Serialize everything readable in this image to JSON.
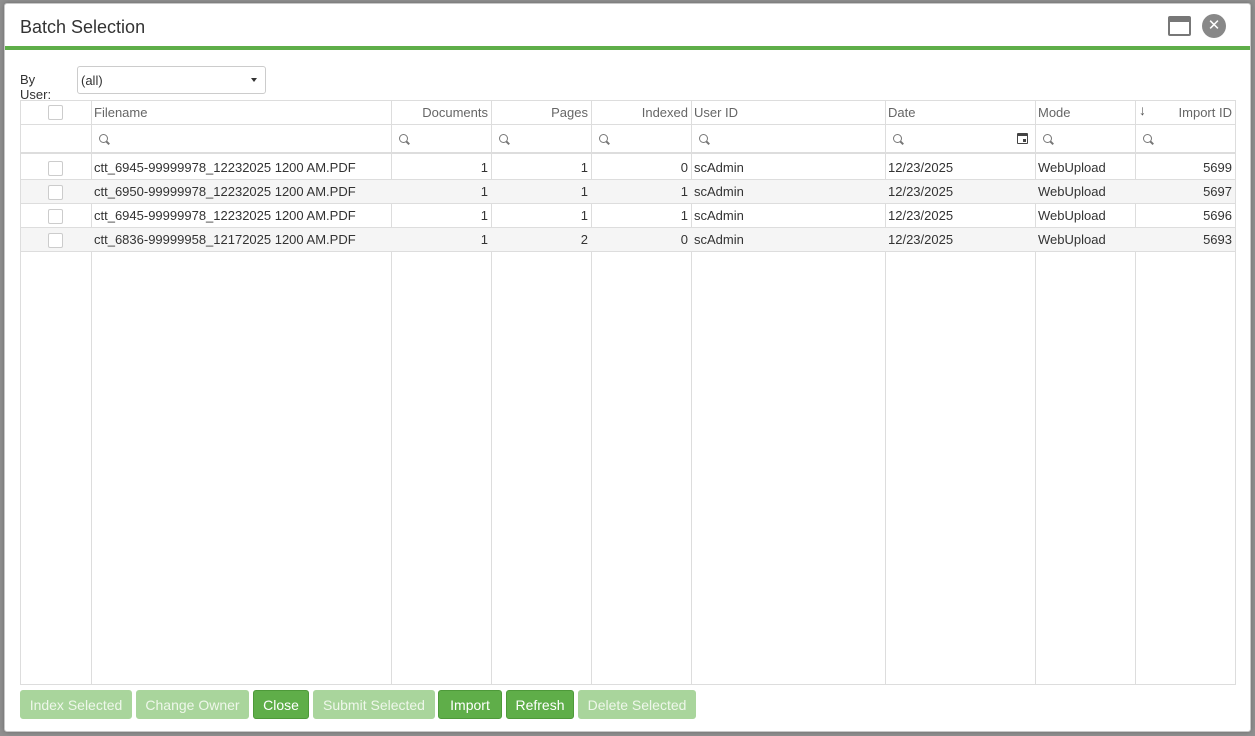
{
  "dialog": {
    "title": "Batch Selection"
  },
  "filter": {
    "label": "By User:",
    "selected": "(all)"
  },
  "grid": {
    "columns": [
      {
        "key": "check",
        "label": ""
      },
      {
        "key": "filename",
        "label": "Filename"
      },
      {
        "key": "documents",
        "label": "Documents"
      },
      {
        "key": "pages",
        "label": "Pages"
      },
      {
        "key": "indexed",
        "label": "Indexed"
      },
      {
        "key": "userid",
        "label": "User ID"
      },
      {
        "key": "date",
        "label": "Date"
      },
      {
        "key": "mode",
        "label": "Mode"
      },
      {
        "key": "importid",
        "label": "Import ID"
      }
    ],
    "sort_column": "importid",
    "rows": [
      {
        "filename": "ctt_6945-99999978_12232025 1200 AM.PDF",
        "documents": "1",
        "pages": "1",
        "indexed": "0",
        "userid": "scAdmin",
        "date": "12/23/2025",
        "mode": "WebUpload",
        "importid": "5699"
      },
      {
        "filename": "ctt_6950-99999978_12232025 1200 AM.PDF",
        "documents": "1",
        "pages": "1",
        "indexed": "1",
        "userid": "scAdmin",
        "date": "12/23/2025",
        "mode": "WebUpload",
        "importid": "5697"
      },
      {
        "filename": "ctt_6945-99999978_12232025 1200 AM.PDF",
        "documents": "1",
        "pages": "1",
        "indexed": "1",
        "userid": "scAdmin",
        "date": "12/23/2025",
        "mode": "WebUpload",
        "importid": "5696"
      },
      {
        "filename": "ctt_6836-99999958_12172025 1200 AM.PDF",
        "documents": "1",
        "pages": "2",
        "indexed": "0",
        "userid": "scAdmin",
        "date": "12/23/2025",
        "mode": "WebUpload",
        "importid": "5693"
      }
    ]
  },
  "buttons": {
    "index_selected": "Index Selected",
    "change_owner": "Change Owner",
    "close": "Close",
    "submit_selected": "Submit Selected",
    "import": "Import",
    "refresh": "Refresh",
    "delete_selected": "Delete Selected"
  },
  "colors": {
    "accent": "#5fae49",
    "accent_disabled": "#a9d59c"
  },
  "icons": [
    "maximize-icon",
    "close-icon",
    "search-icon",
    "calendar-icon",
    "sort-down-icon",
    "chevron-down-icon"
  ]
}
